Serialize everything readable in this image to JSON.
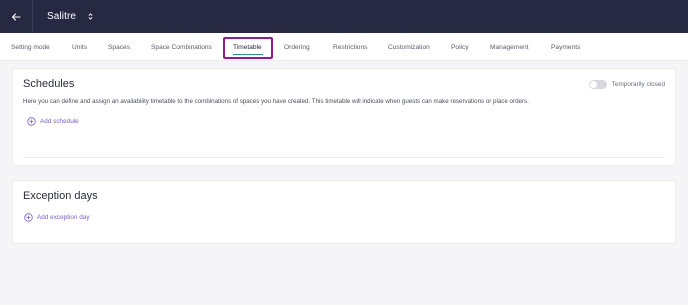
{
  "header": {
    "venue_name": "Salitre",
    "icons": [
      "arrow-left-icon",
      "chevron-updown-icon"
    ]
  },
  "tabs": [
    {
      "label": "Setting mode"
    },
    {
      "label": "Units"
    },
    {
      "label": "Spaces"
    },
    {
      "label": "Space Combinations"
    },
    {
      "label": "Timetable",
      "active": true
    },
    {
      "label": "Ordering"
    },
    {
      "label": "Restrictions"
    },
    {
      "label": "Customization"
    },
    {
      "label": "Policy"
    },
    {
      "label": "Management"
    },
    {
      "label": "Payments"
    }
  ],
  "schedules": {
    "title": "Schedules",
    "description": "Here you can define and assign an availability timetable to the combinations of spaces you have created. This timetable will indicate when guests can make reservations or place orders.",
    "add_label": "Add schedule",
    "toggle_label": "Temporarily closed",
    "toggle_on": false
  },
  "exceptions": {
    "title": "Exception days",
    "add_label": "Add exception day"
  },
  "colors": {
    "topbar": "#272842",
    "accent": "#7b5fc9",
    "highlight": "#8e1f8c",
    "active_underline": "#2a9d7d"
  }
}
